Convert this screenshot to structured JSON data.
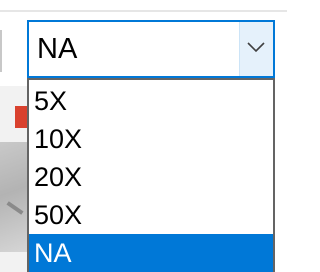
{
  "combo": {
    "value": "NA",
    "button_icon": "chevron-down-icon"
  },
  "dropdown": {
    "options": [
      "5X",
      "10X",
      "20X",
      "50X",
      "NA"
    ],
    "selected": "NA"
  },
  "colors": {
    "accent": "#0078d7",
    "selection_text": "#ffffff",
    "background_mark": "#d9412e"
  }
}
